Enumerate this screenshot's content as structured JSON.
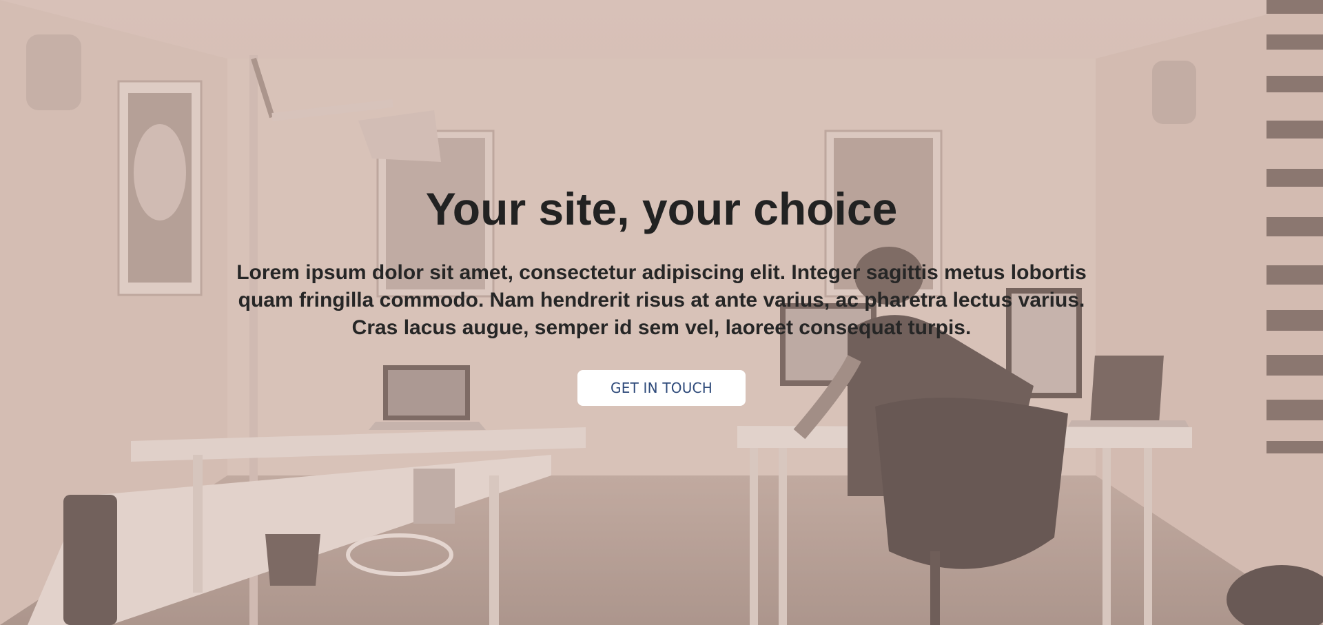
{
  "hero": {
    "title": "Your site, your choice",
    "description": "Lorem ipsum dolor sit amet, consectetur adipiscing elit. Integer sagittis metus lobortis quam fringilla commodo. Nam hendrerit risus at ante varius, ac pharetra lectus varius. Cras lacus augue, semper id sem vel, laoreet consequat turpis.",
    "cta_label": "GET IN TOUCH",
    "overlay_color": "#d9c3b9",
    "text_color": "#222222",
    "button_text_color": "#2e4a7a"
  }
}
